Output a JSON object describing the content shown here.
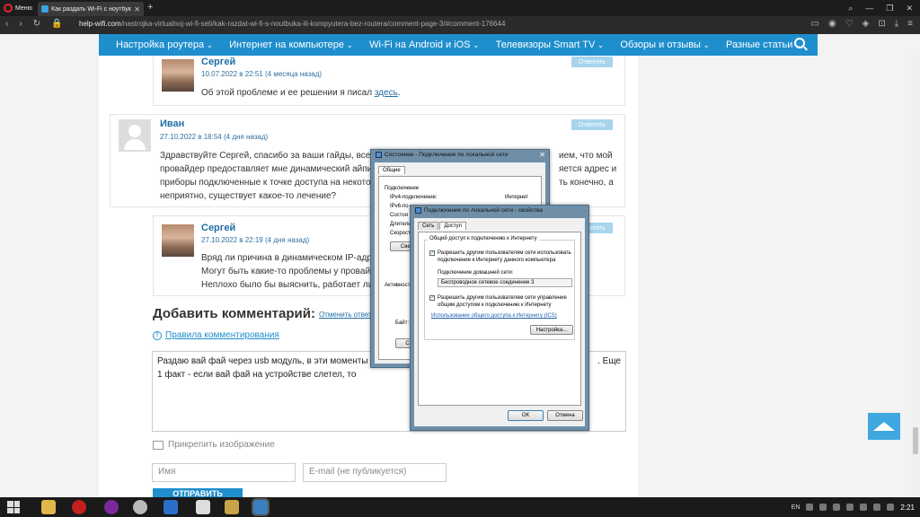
{
  "browser": {
    "menu_label": "Меню",
    "tab_title": "Как раздать Wi-Fi с ноутбук",
    "url_domain": "help-wifi.com",
    "url_path": "/nastrojka-virtualnoj-wi-fi-seti/kak-razdat-wi-fi-s-noutbuka-ili-kompyutera-bez-routera/comment-page-3/#comment-176644"
  },
  "nav": {
    "items": [
      "Настройка роутера",
      "Интернет на компьютере",
      "Wi-Fi на Android и iOS",
      "Телевизоры Smart TV",
      "Обзоры и отзывы",
      "Разные статьи"
    ]
  },
  "comments": [
    {
      "author": "Сергей",
      "date": "10.07.2022 в 22:51 (4 месяца назад)",
      "text_before": "Об этой проблеме и ее решении я писал ",
      "link": "здесь",
      "text_after": ".",
      "reply": "Ответить"
    },
    {
      "author": "Иван",
      "date": "27.10.2022 в 18:54 (4 дня назад)",
      "lines": [
        "Здравствуйте Сергей, спасибо за ваши гайды, все зам",
        "провайдер предоставляет мне динамический айпи. П",
        "приборы подключенные к точке доступа на некоторо",
        "неприятно, существует какое-то лечение?"
      ],
      "right_lines": [
        "ием, что мой",
        "яется адрес и",
        "ть конечно, а"
      ],
      "reply": "Ответить"
    },
    {
      "author": "Сергей",
      "date": "27.10.2022 в 22:19 (4 дня назад)",
      "lines": [
        "Вряд ли причина в динамическом IP-адрес",
        "Могут быть какие-то проблемы у провайде",
        "Неплохо было бы выяснить, работает ли в"
      ],
      "reply": "Ответить"
    }
  ],
  "form": {
    "heading": "Добавить комментарий:",
    "cancel": "Отменить ответ",
    "rules": "Правила комментирования",
    "text_line1": "Раздаю вай фай через usb модуль, в эти моменты",
    "text_line1_right": ". Еще",
    "text_line2": "1 факт - если вай фай на устройстве слетел, то",
    "attach": "Прикрепить изображение",
    "name_placeholder": "Имя",
    "email_placeholder": "E-mail (не публикуется)",
    "submit": "ОТПРАВИТЬ"
  },
  "dialog_status": {
    "title": "Состояние - Подключение по локальной сети",
    "tab": "Общие",
    "section": "Подключение",
    "ipv4_label": "IPv4-подключение:",
    "ipv4_value": "Интернет",
    "ipv6_label": "IPv6-по",
    "state_label": "Состоя",
    "duration_label": "Длитель",
    "speed_label": "Скорост",
    "details_btn": "Свед",
    "activity_label": "Активност",
    "bytes_label": "Байт:",
    "props_btn": "Св"
  },
  "dialog_props": {
    "title": "Подключение по локальной сети - свойства",
    "tab_net": "Сеть",
    "tab_access": "Доступ",
    "group_title": "Общий доступ к подключению к Интернету",
    "chk1_line1": "Разрешить другим пользователям сети использовать",
    "chk1_line2": "подключение к Интернету данного компьютера",
    "home_label": "Подключение домашней сети:",
    "home_value": "Беспроводное сетевое соединение 3",
    "chk2_line1": "Разрешить другим пользователям сети управление",
    "chk2_line2": "общим доступом к подключению к Интернету",
    "ics_link": "Использование общего доступа к Интернету (ICS)",
    "settings_btn": "Настройка...",
    "ok_btn": "ОК",
    "cancel_btn": "Отмена"
  },
  "taskbar": {
    "lang": "EN",
    "time": "2:21"
  }
}
